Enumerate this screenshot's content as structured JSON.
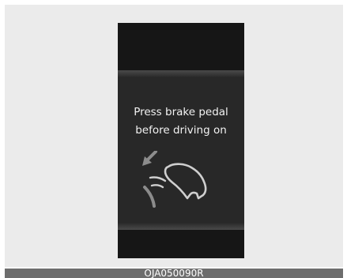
{
  "display": {
    "message_line1": "Press brake pedal",
    "message_line2": "before driving on",
    "icon": "brake-pedal-icon"
  },
  "caption": "OJA050090R",
  "colors": {
    "background": "#ebebeb",
    "display": "#161616",
    "panel": "#282828",
    "text": "#f2f2f2",
    "icon": "#cfcfcf",
    "caption_bar": "#6d6d6d"
  }
}
